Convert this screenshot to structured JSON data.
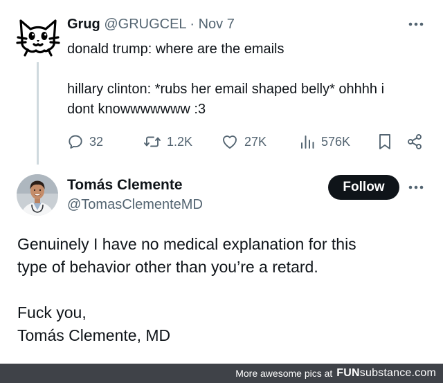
{
  "tweet1": {
    "avatar_icon": "cat-doodle-avatar-icon",
    "name": "Grug",
    "handle": "@GRUGCEL",
    "separator": "·",
    "date": "Nov 7",
    "text_line1": "donald trump: where are the emails",
    "text_line2": "hillary clinton: *rubs her email shaped belly* ohhhh i",
    "text_line3": "dont knowwwwwww :3",
    "replies": "32",
    "retweets": "1.2K",
    "likes": "27K",
    "views": "576K",
    "more_icon": "more-options-icon"
  },
  "tweet2": {
    "name": "Tomás Clemente",
    "handle": "@TomasClementeMD",
    "follow_label": "Follow",
    "text_line1": "Genuinely I have no medical explanation for this",
    "text_line2": "type of behavior other than you’re a retard.",
    "text_line3": "Fuck you,",
    "text_line4": "Tomás Clemente, MD",
    "more_icon": "more-options-icon"
  },
  "watermark": {
    "prefix": "More awesome pics at",
    "brand_fun": "FUN",
    "brand_rest": "substance.com"
  },
  "colors": {
    "text": "#0f1419",
    "secondary": "#536471",
    "thread_line": "#cfd9de",
    "follow_bg": "#0f1419",
    "watermark_bg": "#3f4248"
  }
}
